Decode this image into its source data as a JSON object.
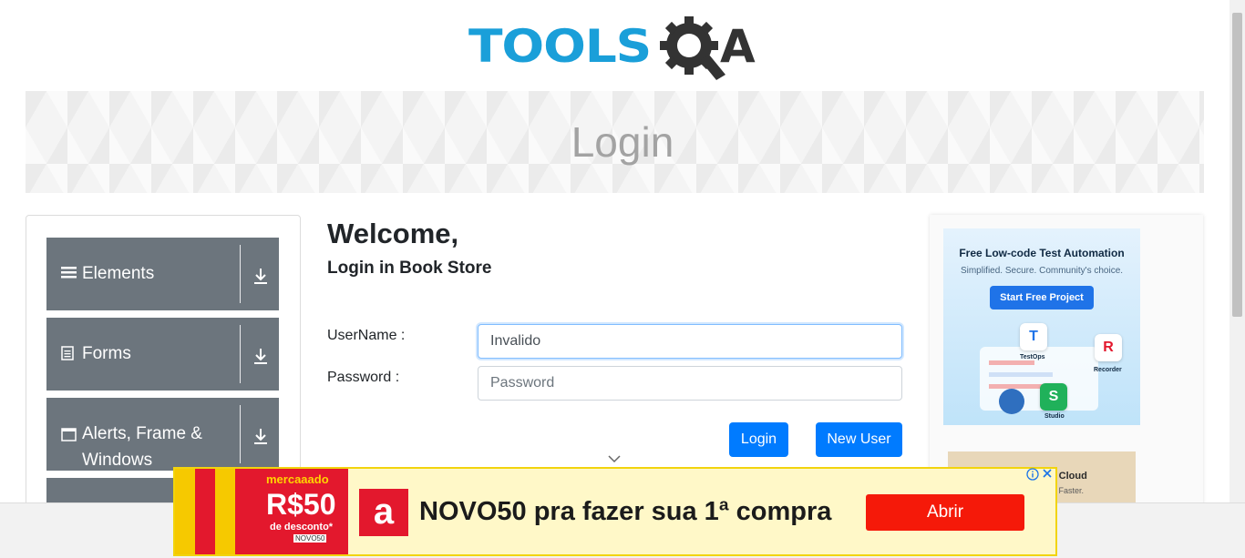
{
  "logo": {
    "brand_text": "TOOLSQA"
  },
  "banner": {
    "title": "Login"
  },
  "sidebar": {
    "groups": [
      {
        "label": "Elements",
        "icon": "menu-icon"
      },
      {
        "label": "Forms",
        "icon": "document-icon"
      },
      {
        "label": "Alerts, Frame &",
        "label2": "Windows",
        "icon": "window-icon"
      },
      {
        "label": "",
        "icon": ""
      }
    ]
  },
  "form": {
    "welcome": "Welcome,",
    "subtitle": "Login in Book Store",
    "username_label": "UserName :",
    "username_value": "Invalido",
    "password_label": "Password :",
    "password_placeholder": "Password",
    "login_button": "Login",
    "new_user_button": "New User"
  },
  "ad_right": {
    "title": "Free Low-code Test Automation",
    "tagline": "Simplified. Secure. Community's choice.",
    "cta": "Start Free Project",
    "products": [
      "TestOps",
      "Recorder",
      "Studio"
    ],
    "secondary_title": "sting On Cloud",
    "secondary_sub": ", Ship Faster."
  },
  "ad_bottom": {
    "image_brand": "mercaaado",
    "image_price": "R$50",
    "image_desc": "de desconto*",
    "image_code": "NOVO50",
    "logo_letter": "a",
    "headline": "NOVO50 pra fazer sua 1ª compra",
    "cta": "Abrir"
  },
  "colors": {
    "accent": "#007bff",
    "sidebar_group": "#6c757d",
    "logo_blue": "#1a9fd9",
    "ad_red": "#f51909"
  }
}
